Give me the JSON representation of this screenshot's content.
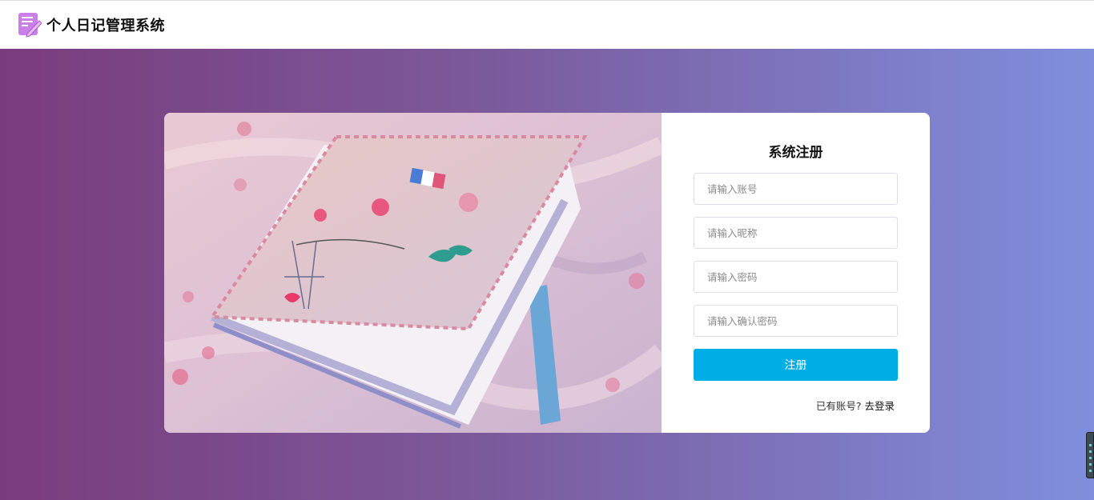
{
  "header": {
    "title": "个人日记管理系统",
    "logo_icon": "notebook-pen-icon"
  },
  "colors": {
    "bg_gradient_start": "#7a3c7c",
    "bg_gradient_end": "#7f8fdd",
    "button": "#00aee6"
  },
  "register": {
    "title": "系统注册",
    "account_placeholder": "请输入账号",
    "nickname_placeholder": "请输入昵称",
    "password_placeholder": "请输入密码",
    "confirm_placeholder": "请输入确认密码",
    "submit_label": "注册",
    "have_account_text": "已有账号?",
    "login_link": "去登录"
  }
}
